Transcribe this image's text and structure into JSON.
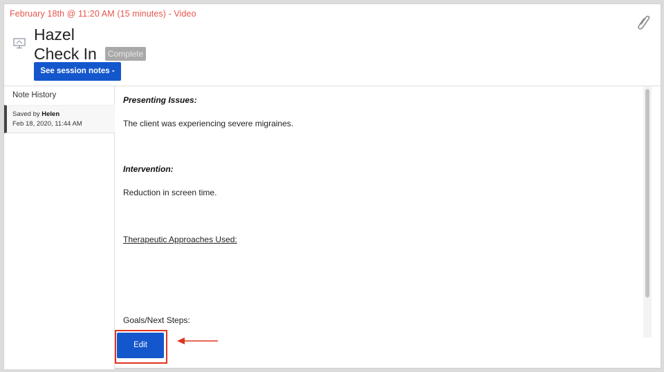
{
  "header": {
    "session_meta": "February 18th @ 11:20 AM (15 minutes) - Video",
    "client_name": "Hazel",
    "session_type": "Check In",
    "status": "Complete",
    "notes_button": "See session notes -",
    "icons": {
      "session_type": "monitor-icon",
      "attachment": "paperclip-icon"
    }
  },
  "sidebar": {
    "title": "Note History",
    "items": [
      {
        "saved_prefix": "Saved by ",
        "saved_by": "Helen",
        "date": "Feb 18, 2020, 11:44 AM"
      }
    ]
  },
  "note": {
    "presenting_issues_heading": "Presenting Issues:",
    "presenting_issues_text": "The client was experiencing severe migraines.",
    "intervention_heading": "Intervention:",
    "intervention_text": "Reduction in screen time.",
    "approaches_heading": "Therapeutic Approaches Used: ",
    "goals_heading": "Goals/Next Steps:"
  },
  "footer": {
    "edit_button": "Edit"
  },
  "colors": {
    "accent_blue": "#1457cc",
    "meta_red": "#e8554e",
    "annotation_red": "#e0341f",
    "badge_gray": "#a9a9a9"
  }
}
